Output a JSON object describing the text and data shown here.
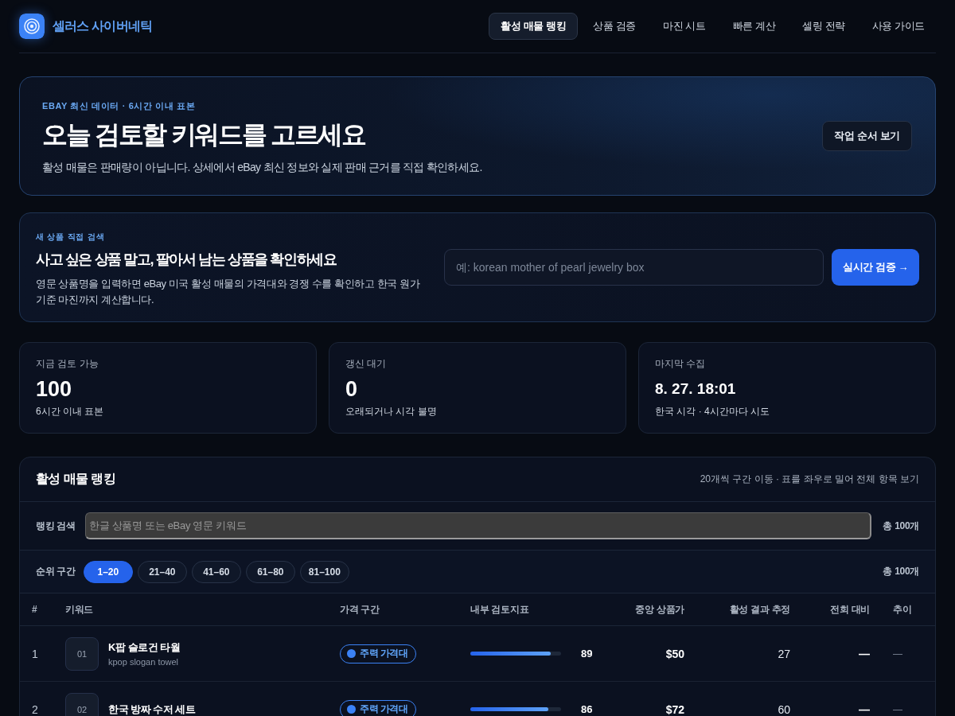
{
  "header": {
    "brand": "셀러스 사이버네틱",
    "nav": [
      {
        "label": "활성 매물 랭킹",
        "selected": true
      },
      {
        "label": "상품 검증",
        "selected": false
      },
      {
        "label": "마진 시트",
        "selected": false
      },
      {
        "label": "빠른 계산",
        "selected": false
      },
      {
        "label": "셀링 전략",
        "selected": false
      },
      {
        "label": "사용 가이드",
        "selected": false
      }
    ]
  },
  "hero": {
    "eyebrow": "EBAY 최신 데이터 · 6시간 이내 표본",
    "title": "오늘 검토할 키워드를 고르세요",
    "subtitle": "활성 매물은 판매량이 아닙니다. 상세에서 eBay 최신 정보와 실제 판매 근거를 직접 확인하세요.",
    "button": "작업 순서 보기"
  },
  "direct_search": {
    "eyebrow": "새 상품 직접 검색",
    "title": "사고 싶은 상품 말고, 팔아서 남는 상품을 확인하세요",
    "description": "영문 상품명을 입력하면 eBay 미국 활성 매물의 가격대와 경쟁 수를 확인하고 한국 원가 기준 마진까지 계산합니다.",
    "placeholder": "예: korean mother of pearl jewelry box",
    "button": "실시간 검증 →"
  },
  "stats": [
    {
      "kind": "count",
      "label": "지금 검토 가능",
      "value": "100",
      "note": "6시간 이내 표본"
    },
    {
      "kind": "count",
      "label": "갱신 대기",
      "value": "0",
      "note": "오래되거나 시각 불명"
    },
    {
      "kind": "time",
      "label": "마지막 수집",
      "value": "8. 27. 18:01",
      "note": "한국 시각 · 4시간마다 시도"
    }
  ],
  "ranking": {
    "title": "활성 매물 랭킹",
    "hint": "20개씩 구간 이동 · 표를 좌우로 밀어 전체 항목 보기",
    "search": {
      "label": "랭킹 검색",
      "placeholder": "한글 상품명 또는 eBay 영문 키워드",
      "count": "총 100개"
    },
    "ranges": {
      "label": "순위 구간",
      "items": [
        {
          "label": "1–20",
          "selected": true
        },
        {
          "label": "21–40",
          "selected": false
        },
        {
          "label": "41–60",
          "selected": false
        },
        {
          "label": "61–80",
          "selected": false
        },
        {
          "label": "81–100",
          "selected": false
        }
      ],
      "count": "총 100개"
    },
    "columns": [
      "#",
      "키워드",
      "가격 구간",
      "내부 검토지표",
      "중앙 상품가",
      "활성 결과 추정",
      "전회 대비",
      "추이"
    ],
    "rows": [
      {
        "rank": "1",
        "thumb": "01",
        "title": "K팝 슬로건 타월",
        "subtitle": "kpop slogan towel",
        "price_band": "주력 가격대",
        "level": 0.89,
        "score": "89",
        "median_price": "$50",
        "active_results": "27",
        "change": "—",
        "trend": "—"
      },
      {
        "rank": "2",
        "thumb": "02",
        "title": "한국 방짜 수저 세트",
        "price_band": "주력 가격대",
        "level": 0.86,
        "score": "86",
        "median_price": "$72",
        "active_results": "60",
        "change": "—",
        "trend": "—"
      }
    ]
  }
}
